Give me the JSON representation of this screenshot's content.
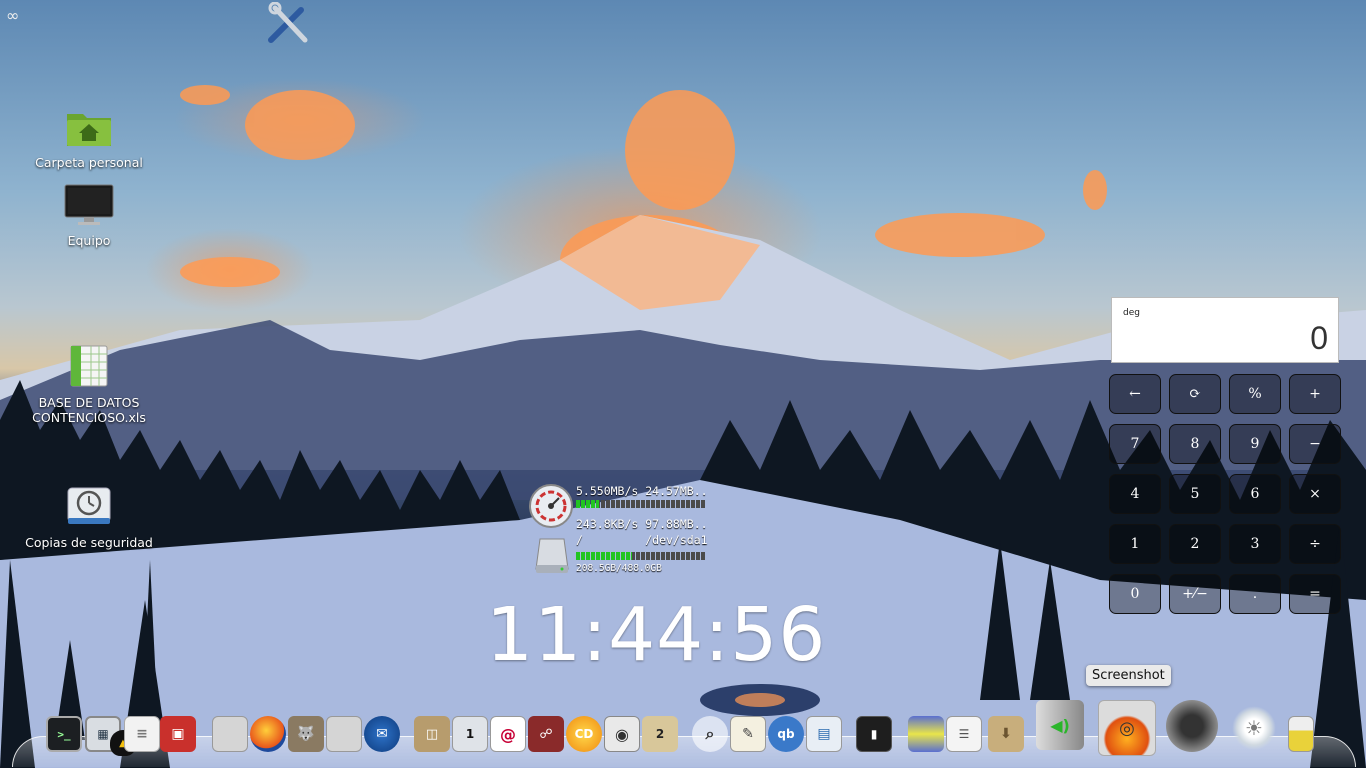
{
  "topbar": {
    "glyph": "∞"
  },
  "desktop": {
    "icons": [
      {
        "label": "Carpeta personal",
        "icon": "home-folder-icon"
      },
      {
        "label": "Equipo",
        "icon": "computer-icon"
      },
      {
        "label": "BASE DE DATOS CONTENCIOSO.xls",
        "label_line1": "BASE DE DATOS",
        "label_line2": "CONTENCIOSO.xls",
        "icon": "spreadsheet-icon"
      },
      {
        "label": "Copias de seguridad",
        "icon": "backup-icon"
      }
    ]
  },
  "sysmon": {
    "net_line": "5.550MB/s 24.57MB..",
    "net_fill_pct": 18,
    "disk_io_line": "243.8KB/s 97.88MB..",
    "mount_line": "/         /dev/sda1",
    "disk_usage": "208.5GB/488.0GB",
    "disk_fill_pct": 43
  },
  "clock": {
    "time": "11:44:56"
  },
  "calculator": {
    "mode": "deg",
    "display": "0",
    "keys": [
      [
        "←",
        "⟳",
        "%",
        "+"
      ],
      [
        "7",
        "8",
        "9",
        "−"
      ],
      [
        "4",
        "5",
        "6",
        "×"
      ],
      [
        "1",
        "2",
        "3",
        "÷"
      ],
      [
        "0",
        "+⁄−",
        ".",
        "="
      ]
    ]
  },
  "tooltip": {
    "text": "Screenshot"
  },
  "dock": {
    "badges": {
      "workspace": "1",
      "archive": "2",
      "qbittorrent": "qb",
      "cd": "CD"
    },
    "items": [
      "terminal-icon",
      "system-monitor-icon",
      "linux-tux-icon",
      "text-document-icon",
      "package-installer-icon",
      "file-icon",
      "firefox-icon",
      "gimp-icon",
      "file-icon-2",
      "thunderbird-icon",
      "archive-manager-icon",
      "workspace-switcher-icon",
      "debian-icon",
      "pidgin-icon",
      "cd-burner-icon",
      "audio-player-icon",
      "archive-icon",
      "search-icon",
      "text-editor-icon",
      "qbittorrent-icon",
      "image-viewer-icon",
      "mobile-device-icon",
      "video-editor-icon",
      "document-viewer-icon",
      "downloads-folder-icon",
      "volume-icon",
      "screenshot-icon",
      "speaker-icon",
      "brightness-icon",
      "battery-icon"
    ]
  },
  "colors": {
    "dock_highlight": "#ffffff",
    "progress_green": "#22c422",
    "calc_bg": "#ffffff"
  }
}
